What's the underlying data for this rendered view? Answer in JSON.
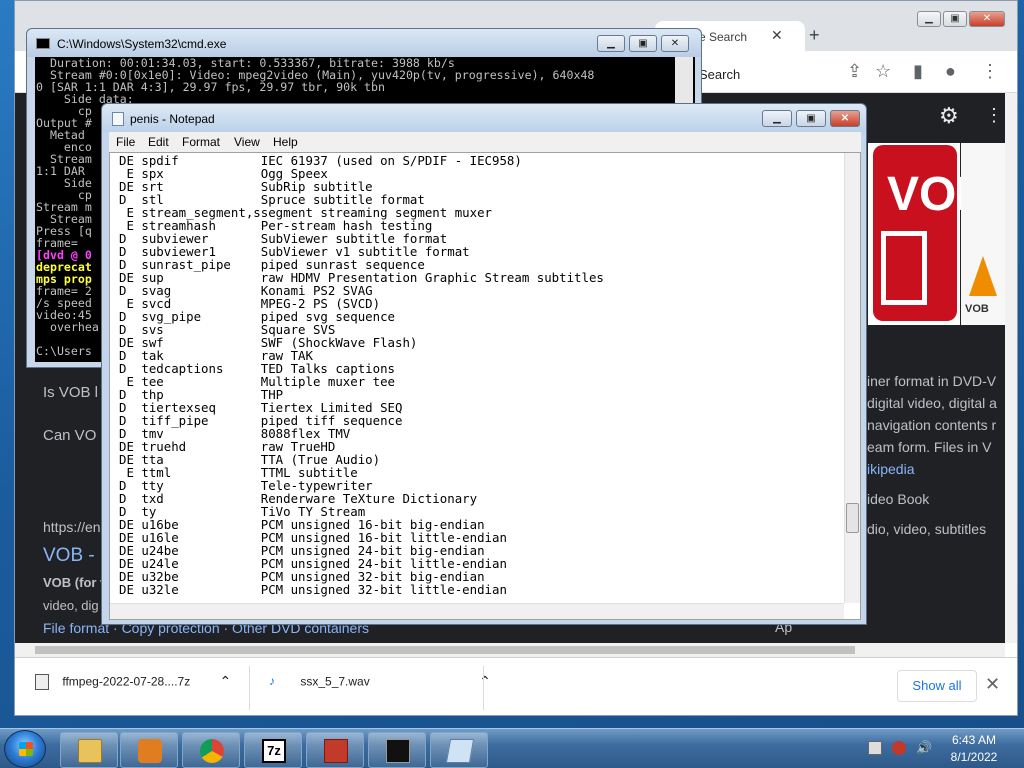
{
  "chrome": {
    "tab_title": "e Search",
    "search_label": "Search",
    "results": {
      "q1": "Is VOB l",
      "q2": "Can VO",
      "url": "https://en",
      "heading": "VOB -",
      "snippet1": "VOB (for v",
      "snippet2": "video, dig",
      "links": "File format · Copy protection · Other DVD containers",
      "right_text1": "iner format in DVD-V",
      "right_text2": "digital video, digital a",
      "right_text3": "navigation contents r",
      "right_text4": "eam form. Files in V",
      "right_link": "ikipedia",
      "right_text5": "ideo Book",
      "right_text6": "dio, video, subtitles",
      "right_text7": "Ap",
      "vob_letters": "VOB",
      "vlc_label": "VOB"
    }
  },
  "downloads": {
    "item1": "ffmpeg-2022-07-28....7z",
    "item2": "ssx_5_7.wav",
    "show_all": "Show all"
  },
  "cmd": {
    "title": "C:\\Windows\\System32\\cmd.exe",
    "lines": [
      "  Duration: 00:01:34.03, start: 0.533367, bitrate: 3988 kb/s",
      "  Stream #0:0[0x1e0]: Video: mpeg2video (Main), yuv420p(tv, progressive), 640x48",
      "0 [SAR 1:1 DAR 4:3], 29.97 fps, 29.97 tbr, 90k tbn",
      "    Side data:",
      "      cp",
      "Output #",
      "  Metad",
      "    enco",
      "  Stream",
      "1:1 DAR",
      "    Side",
      "      cp",
      "Stream m",
      "  Stream",
      "Press [q",
      "frame=",
      "[dvd @ 0",
      "deprecat",
      "mps prop",
      "frame= 2",
      "/s speed",
      "video:45",
      "  overhea",
      "",
      "C:\\Users"
    ]
  },
  "notepad": {
    "title": "penis - Notepad",
    "menu": [
      "File",
      "Edit",
      "Format",
      "View",
      "Help"
    ],
    "lines": [
      "DE spdif           IEC 61937 (used on S/PDIF - IEC958)",
      " E spx             Ogg Speex",
      "DE srt             SubRip subtitle",
      "D  stl             Spruce subtitle format",
      " E stream_segment,ssegment streaming segment muxer",
      " E streamhash      Per-stream hash testing",
      "D  subviewer       SubViewer subtitle format",
      "D  subviewer1      SubViewer v1 subtitle format",
      "D  sunrast_pipe    piped sunrast sequence",
      "DE sup             raw HDMV Presentation Graphic Stream subtitles",
      "D  svag            Konami PS2 SVAG",
      " E svcd            MPEG-2 PS (SVCD)",
      "D  svg_pipe        piped svg sequence",
      "D  svs             Square SVS",
      "DE swf             SWF (ShockWave Flash)",
      "D  tak             raw TAK",
      "D  tedcaptions     TED Talks captions",
      " E tee             Multiple muxer tee",
      "D  thp             THP",
      "D  tiertexseq      Tiertex Limited SEQ",
      "D  tiff_pipe       piped tiff sequence",
      "D  tmv             8088flex TMV",
      "DE truehd          raw TrueHD",
      "DE tta             TTA (True Audio)",
      " E ttml            TTML subtitle",
      "D  tty             Tele-typewriter",
      "D  txd             Renderware TeXture Dictionary",
      "D  ty              TiVo TY Stream",
      "DE u16be           PCM unsigned 16-bit big-endian",
      "DE u16le           PCM unsigned 16-bit little-endian",
      "DE u24be           PCM unsigned 24-bit big-endian",
      "DE u24le           PCM unsigned 24-bit little-endian",
      "DE u32be           PCM unsigned 32-bit big-endian",
      "DE u32le           PCM unsigned 32-bit little-endian"
    ]
  },
  "taskbar": {
    "time": "6:43 AM",
    "date": "8/1/2022",
    "sevenzip_label": "7z"
  }
}
